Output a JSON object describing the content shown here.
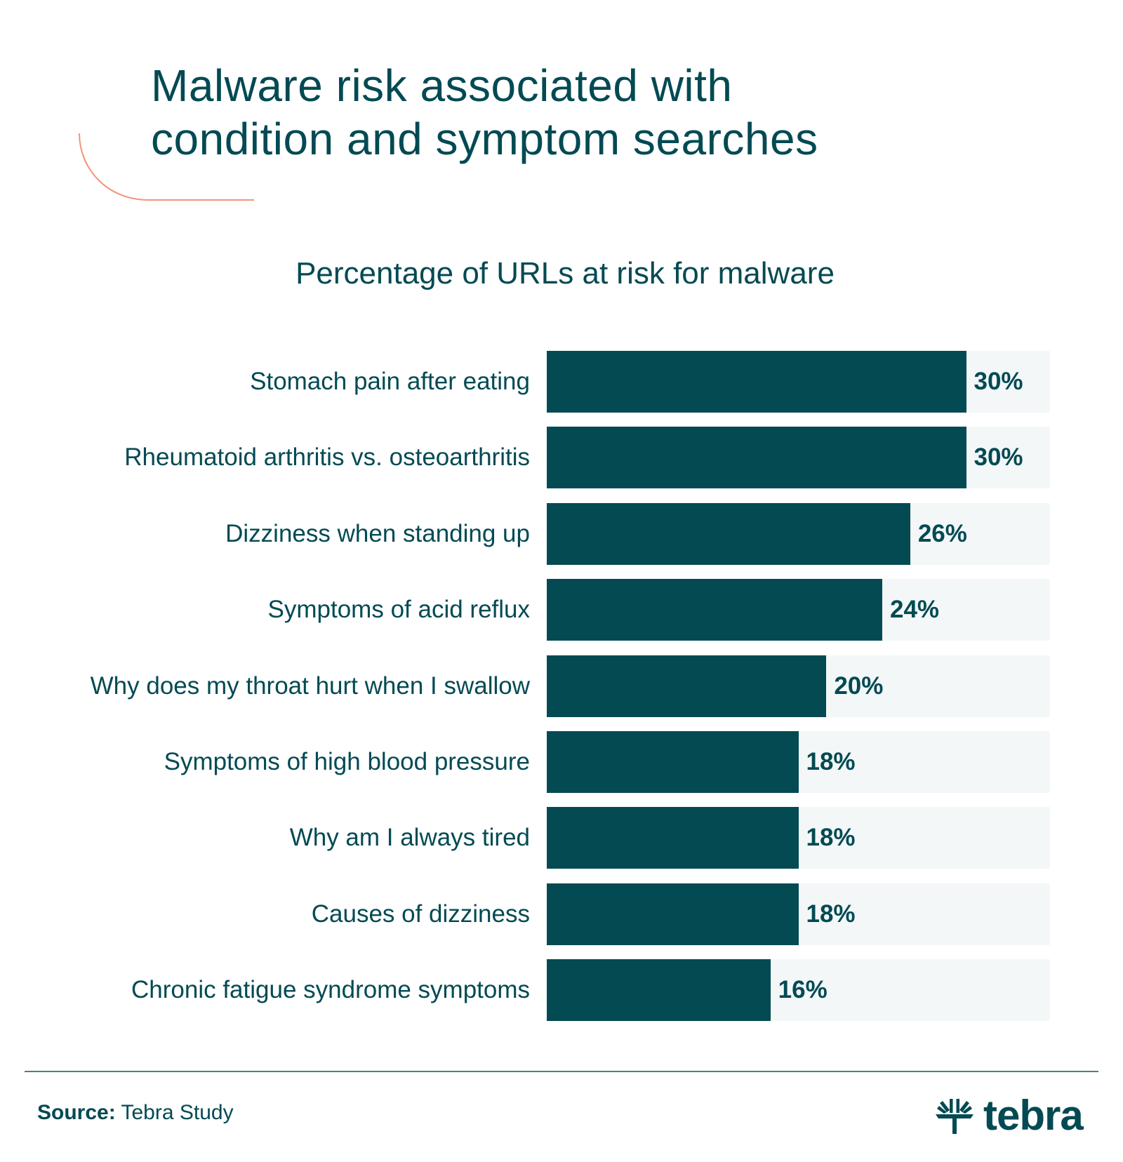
{
  "title": {
    "line1": "Malware risk associated with",
    "line2": "condition and symptom searches"
  },
  "colors": {
    "primary": "#034a53",
    "track": "#f3f7f8",
    "accent": "#f4937a",
    "divider": "#4d7f86"
  },
  "chart_data": {
    "type": "bar",
    "orientation": "horizontal",
    "title": "Percentage of URLs at risk for malware",
    "xlabel": "",
    "ylabel": "",
    "xlim": [
      0,
      36
    ],
    "grid": false,
    "value_suffix": "%",
    "categories": [
      "Stomach pain after eating",
      "Rheumatoid arthritis vs. osteoarthritis",
      "Dizziness when standing up",
      "Symptoms of acid reflux",
      "Why does my throat hurt when I swallow",
      "Symptoms of high blood pressure",
      "Why am I always tired",
      "Causes of dizziness",
      "Chronic fatigue syndrome symptoms"
    ],
    "values": [
      30,
      30,
      26,
      24,
      20,
      18,
      18,
      18,
      16
    ],
    "data_labels": [
      "30%",
      "30%",
      "26%",
      "24%",
      "20%",
      "18%",
      "18%",
      "18%",
      "16%"
    ]
  },
  "footer": {
    "source_label": "Source:",
    "source_value": "Tebra Study",
    "logo_text": "tebra",
    "logo_icon": "tebra-tree-icon"
  }
}
